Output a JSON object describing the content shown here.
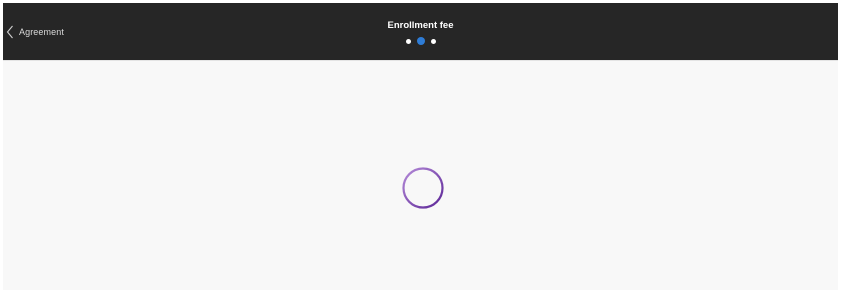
{
  "header": {
    "back_label": "Agreement",
    "title": "Enrollment fee",
    "steps": {
      "total": 3,
      "current": 2
    }
  },
  "colors": {
    "header_bg": "#262626",
    "active_step": "#2e7cd6",
    "inactive_step": "#ffffff",
    "spinner": "#7b3fb3",
    "page_bg": "#f8f8f8"
  },
  "icons": {
    "back": "chevron-left-icon",
    "loading": "loading-spinner-icon"
  }
}
